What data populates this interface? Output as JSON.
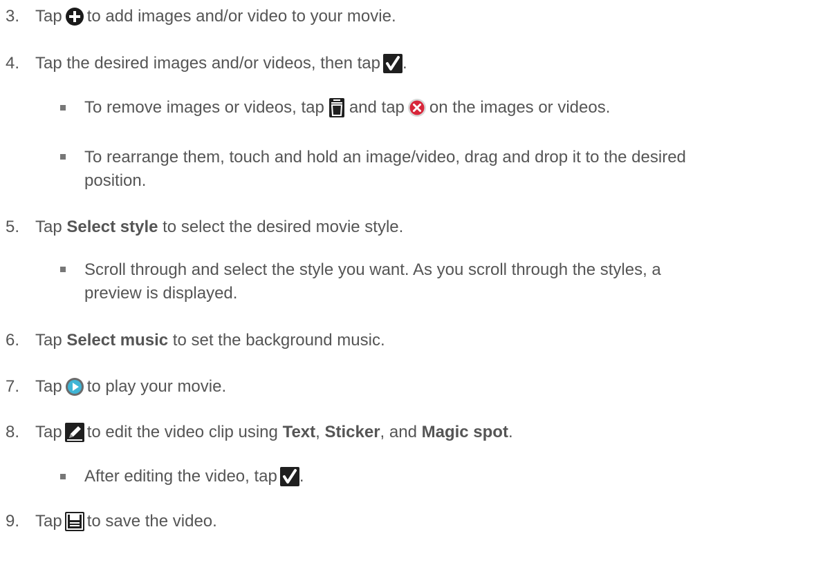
{
  "steps": {
    "s3": {
      "num": "3.",
      "pre": "Tap",
      "icon": "plus-circle-icon",
      "post": "to add images and/or video to your movie."
    },
    "s4": {
      "num": "4.",
      "pre": "Tap the desired images and/or videos, then tap",
      "icon": "checkmark-icon",
      "post": "."
    },
    "s4a": {
      "pre": "To remove images or videos, tap",
      "icon1": "trash-icon",
      "mid": "and tap",
      "icon2": "remove-x-icon",
      "post": "on the images or videos."
    },
    "s4b": {
      "line1": "To rearrange them, touch and hold an image/video, drag and drop it to the desired",
      "line2": "position."
    },
    "s5": {
      "num": "5.",
      "pre": "Tap",
      "bold": "Select style",
      "post": "to select the desired movie style."
    },
    "s5a": {
      "line1": "Scroll through and select the style you want. As you scroll through the styles, a",
      "line2": "preview is displayed."
    },
    "s6": {
      "num": "6.",
      "pre": "Tap",
      "bold": "Select music",
      "post": "to set the background music."
    },
    "s7": {
      "num": "7.",
      "pre": "Tap",
      "icon": "play-icon",
      "post": "to play your movie."
    },
    "s8": {
      "num": "8.",
      "pre": "Tap",
      "icon": "pencil-icon",
      "mid1": "to edit the video clip using",
      "b1": "Text",
      "mid2": ",",
      "b2": "Sticker",
      "mid3": ", and",
      "b3": "Magic spot",
      "post": "."
    },
    "s8a": {
      "pre": "After editing the video, tap",
      "icon": "checkmark-icon",
      "post": "."
    },
    "s9": {
      "num": "9.",
      "pre": "Tap",
      "icon": "save-icon",
      "post": "to save the video."
    }
  }
}
